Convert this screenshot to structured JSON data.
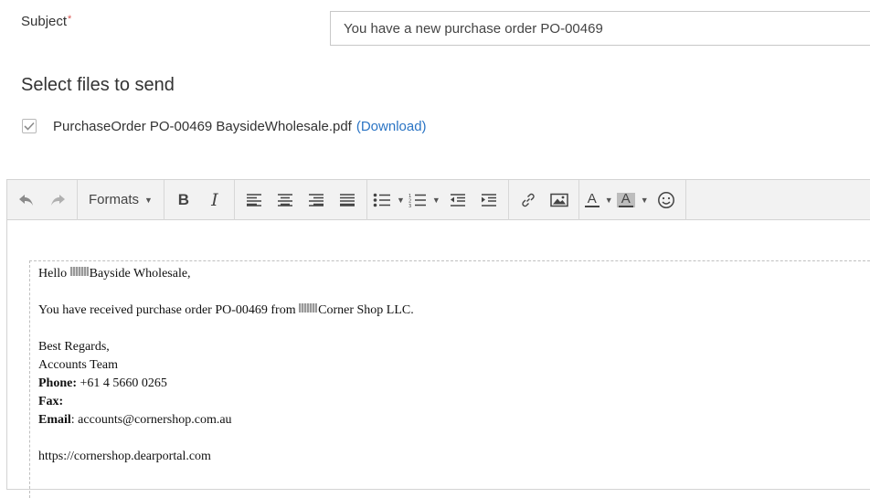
{
  "subject": {
    "label": "Subject",
    "required_mark": "*",
    "value": "You have a new purchase order PO-00469"
  },
  "files": {
    "heading": "Select files to send",
    "items": [
      {
        "name": "PurchaseOrder PO-00469 BaysideWholesale.pdf",
        "download_label": "(Download)",
        "checked": true
      }
    ]
  },
  "toolbar": {
    "formats_label": "Formats",
    "bold_label": "B",
    "italic_label": "I",
    "text_color_label": "A",
    "bg_color_label": "A",
    "icons": [
      "undo-icon",
      "redo-icon",
      "align-left-icon",
      "align-center-icon",
      "align-right-icon",
      "align-justify-icon",
      "bullet-list-icon",
      "numbered-list-icon",
      "outdent-icon",
      "indent-icon",
      "link-icon",
      "image-icon",
      "emoji-icon"
    ]
  },
  "body": {
    "greeting_prefix": "Hello ",
    "greeting_name": "Bayside Wholesale,",
    "line_prefix": "You have received purchase order PO-00469 from ",
    "line_company": "Corner Shop LLC.",
    "regards": "Best Regards,",
    "team": "Accounts Team",
    "phone_label": "Phone:",
    "phone_value": " +61 4 5660 0265",
    "fax_label": "Fax:",
    "email_label": "Email",
    "email_value": ": accounts@cornershop.com.au",
    "portal_url": "https://cornershop.dearportal.com"
  }
}
